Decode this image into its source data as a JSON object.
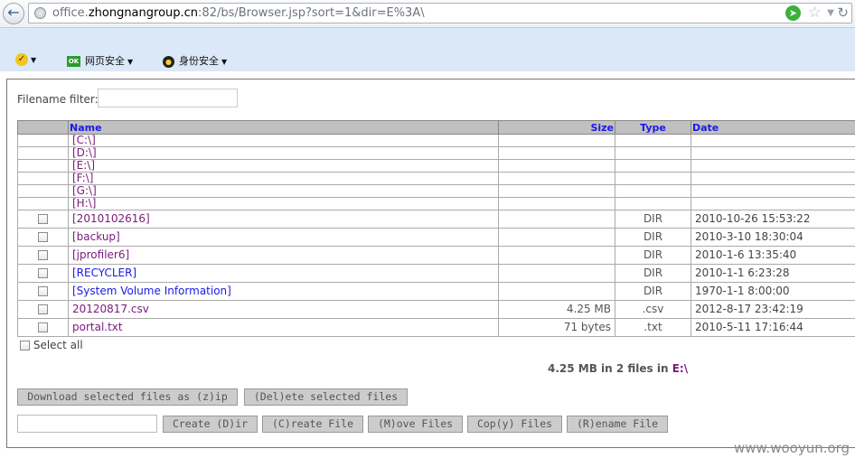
{
  "browser": {
    "url_prefix": "office.",
    "url_domain": "zhongnangroup.cn",
    "url_rest": ":82/bs/Browser.jsp?sort=1&dir=E%3A\\",
    "icons": {
      "back": "back-arrow-icon",
      "site": "globe-icon",
      "go": "go-arrow-icon",
      "favorite": "star-icon",
      "dropdown": "triangle-down-icon",
      "refresh": "refresh-icon"
    }
  },
  "toolbar": {
    "web_safety": "网页安全",
    "id_safety": "身份安全"
  },
  "filter": {
    "label": "Filename filter:",
    "value": ""
  },
  "table": {
    "headers": {
      "name": "Name",
      "size": "Size",
      "type": "Type",
      "date": "Date"
    },
    "drives": [
      "[C:\\]",
      "[D:\\]",
      "[E:\\]",
      "[F:\\]",
      "[G:\\]",
      "[H:\\]"
    ],
    "entries": [
      {
        "name": "[2010102616]",
        "size": "",
        "type": "DIR",
        "date": "2010-10-26 15:53:22",
        "visited": true
      },
      {
        "name": "[backup]",
        "size": "",
        "type": "DIR",
        "date": "2010-3-10 18:30:04",
        "visited": true
      },
      {
        "name": "[jprofiler6]",
        "size": "",
        "type": "DIR",
        "date": "2010-1-6 13:35:40",
        "visited": true
      },
      {
        "name": "[RECYCLER]",
        "size": "",
        "type": "DIR",
        "date": "2010-1-1 6:23:28",
        "visited": false
      },
      {
        "name": "[System Volume Information]",
        "size": "",
        "type": "DIR",
        "date": "1970-1-1 8:00:00",
        "visited": false
      },
      {
        "name": "20120817.csv",
        "size": "4.25 MB",
        "type": ".csv",
        "date": "2012-8-17 23:42:19",
        "visited": true
      },
      {
        "name": "portal.txt",
        "size": "71 bytes",
        "type": ".txt",
        "date": "2010-5-11 17:16:44",
        "visited": true
      }
    ]
  },
  "select_all": "Select all",
  "summary": {
    "text": "4.25 MB in 2 files in ",
    "drive": "E:\\"
  },
  "buttons": {
    "download_zip": "Download selected files as (z)ip",
    "delete": "(Del)ete selected files",
    "create_dir": "Create (D)ir",
    "create_file": "(C)reate File",
    "move": "(M)ove Files",
    "copy": "Cop(y) Files",
    "rename": "(R)ename File"
  },
  "new_name_value": "",
  "watermark": "www.wooyun.org",
  "colors": {
    "link_visited": "#7b1a7b",
    "link_unvisited": "#1a1ae6",
    "header_bg": "#c0c0c0",
    "toolbar_bg": "#dbe8f7"
  }
}
